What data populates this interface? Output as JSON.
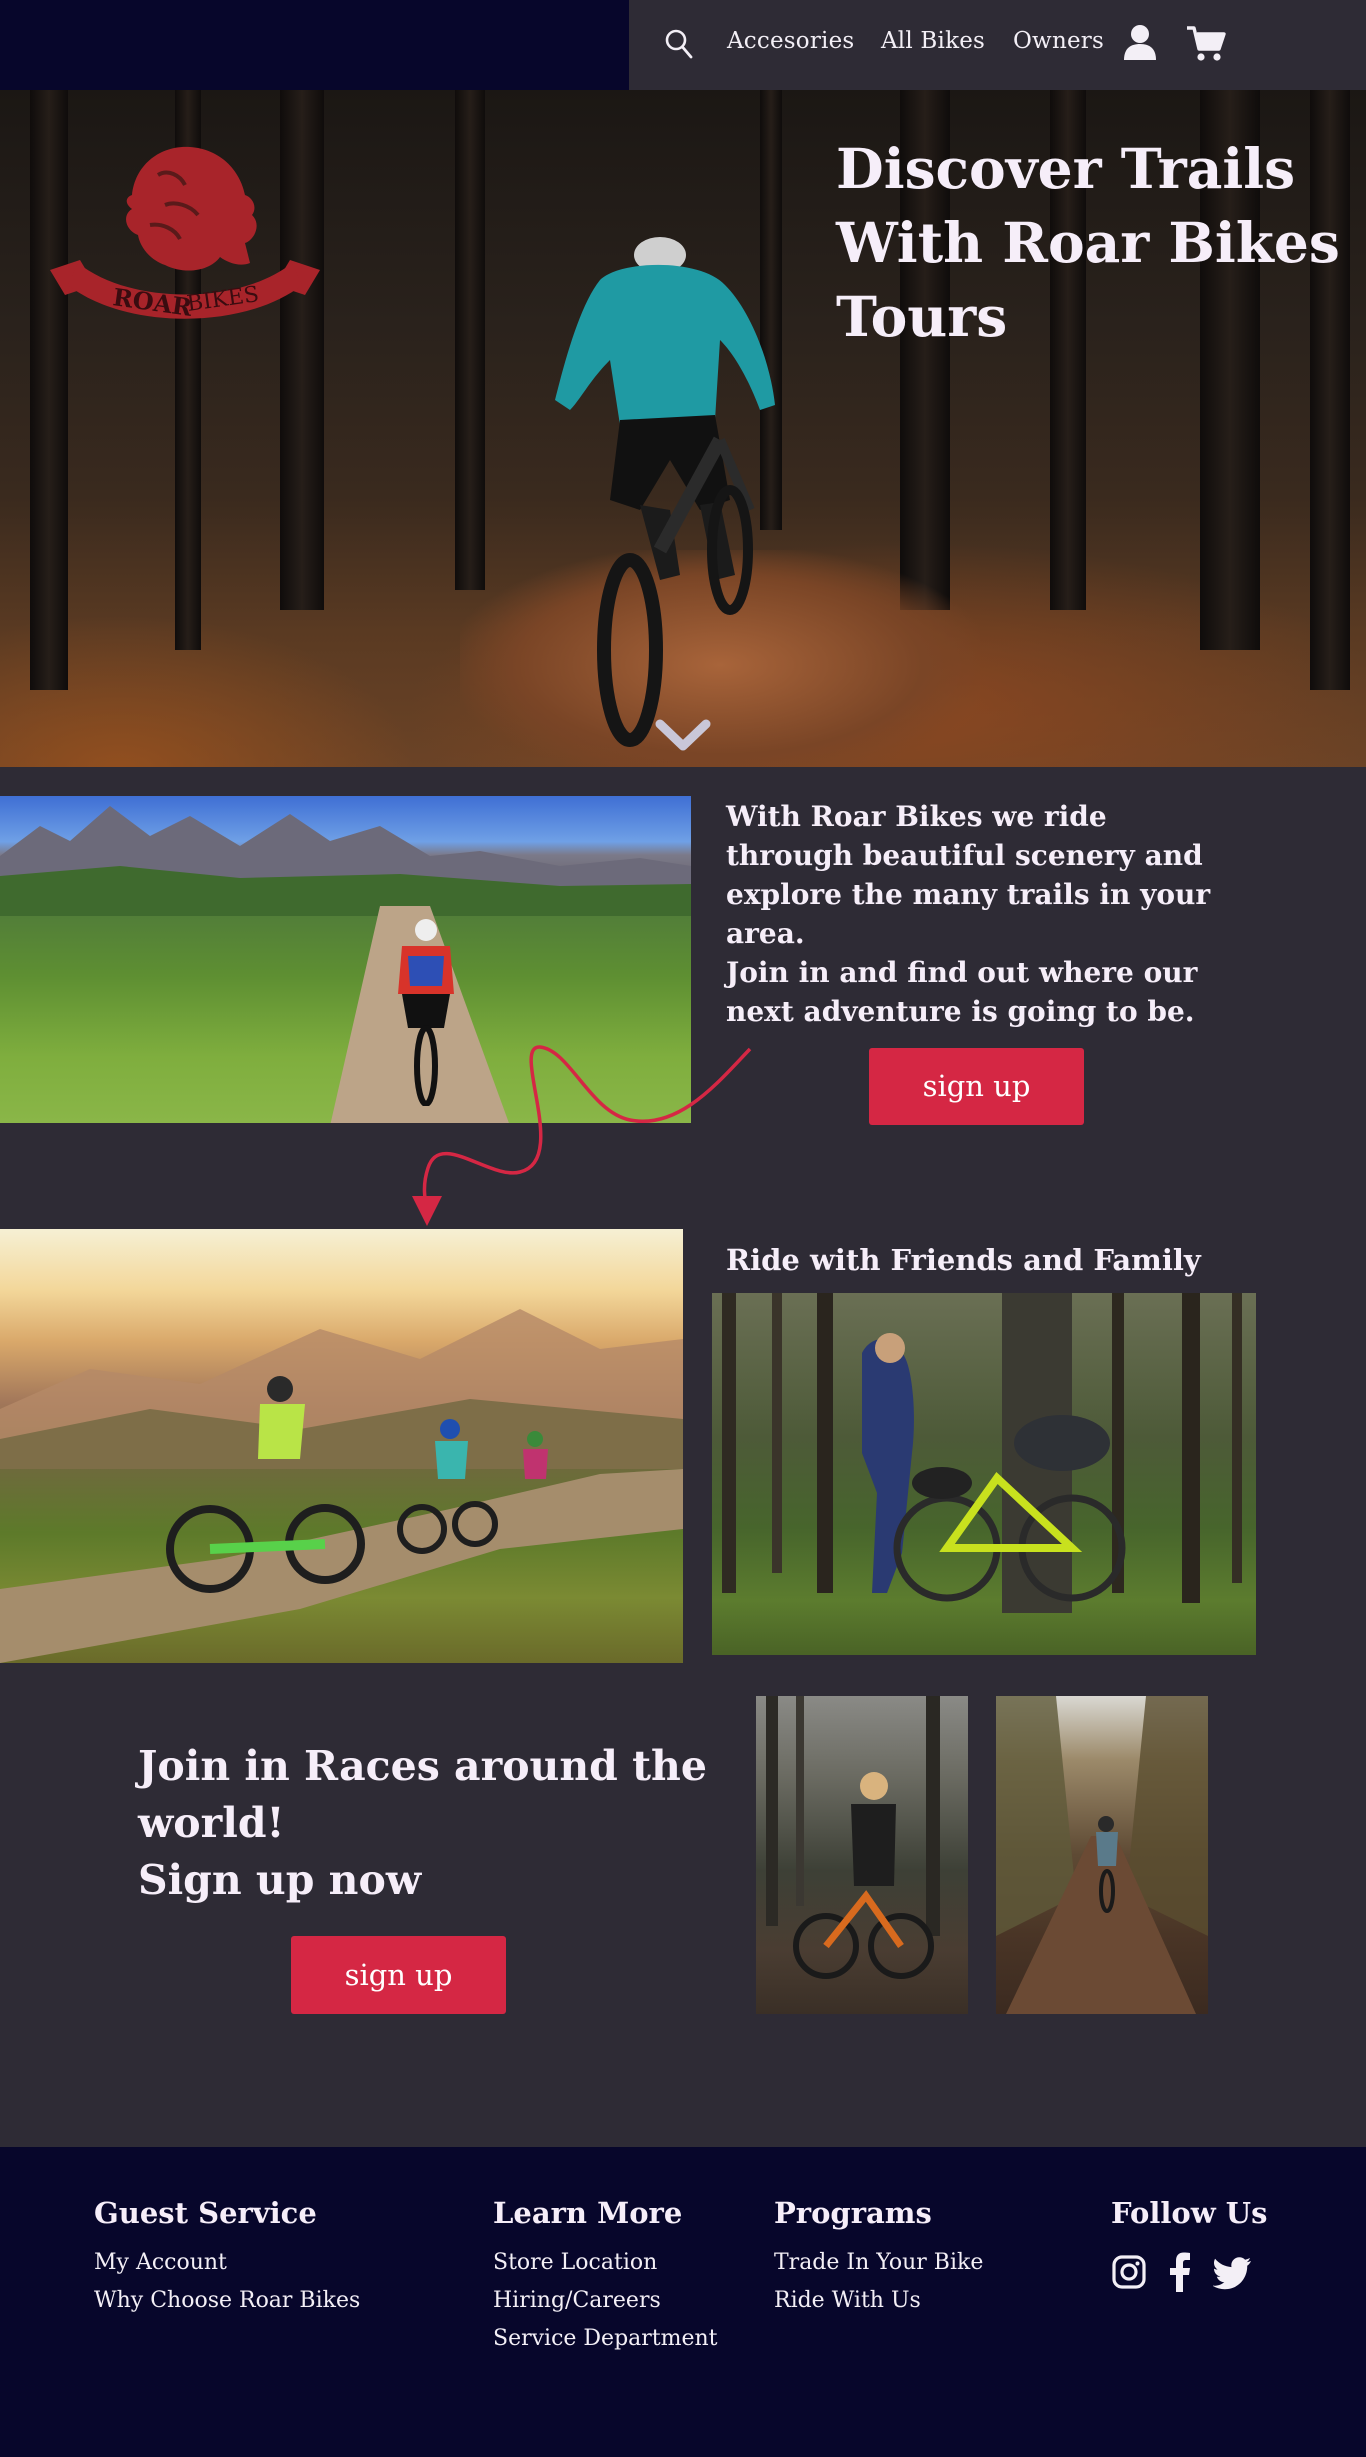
{
  "nav": {
    "links": [
      "Accesories",
      "All Bikes",
      "Owners"
    ],
    "icons": [
      "search-icon",
      "user-icon",
      "cart-icon"
    ]
  },
  "hero": {
    "logo_text": "ROAR BIKES",
    "title": "Discover Trails With Roar Bikes Tours",
    "icon": "chevron-down-icon"
  },
  "intro": {
    "text_lines": [
      "With Roar Bikes we ride",
      "through beautiful scenery and",
      "explore the many trails in your",
      "area.",
      "Join in and find out where our",
      "next adventure is going to be."
    ],
    "button": "sign up"
  },
  "family": {
    "title": "Ride with Friends and Family"
  },
  "races": {
    "lines": [
      "Join in Races around the",
      "world!",
      "Sign up now"
    ],
    "button": "sign up"
  },
  "footer": {
    "columns": [
      {
        "title": "Guest Service",
        "links": [
          "My Account",
          "Why Choose Roar Bikes"
        ]
      },
      {
        "title": "Learn More",
        "links": [
          "Store Location",
          "Hiring/Careers",
          "Service Department"
        ]
      },
      {
        "title": "Programs",
        "links": [
          "Trade In Your Bike",
          "Ride With Us"
        ]
      },
      {
        "title": "Follow Us",
        "links": []
      }
    ],
    "social": [
      "instagram-icon",
      "facebook-icon",
      "twitter-icon"
    ]
  },
  "colors": {
    "page_bg": "#2e2b35",
    "header_dark": "#07062b",
    "accent": "#d52744",
    "logo_red": "#a8242a",
    "text": "#f6eef9"
  }
}
